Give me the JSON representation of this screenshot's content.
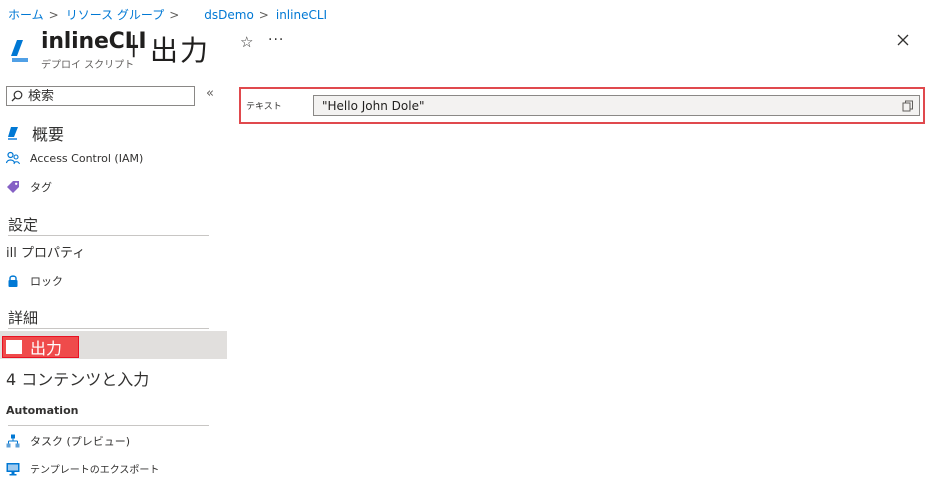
{
  "breadcrumb": {
    "home": "ホーム",
    "resource_groups": "リソース グループ",
    "resource_group": "dsDemo",
    "current": "inlineCLI",
    "separator": ">"
  },
  "header": {
    "title": "inlineCLI",
    "divider": "|",
    "page": "出力",
    "subtitle": "デプロイ スクリプト",
    "more": "···"
  },
  "search": {
    "placeholder": "検索",
    "collapse": "«"
  },
  "nav": {
    "overview": "概要",
    "iam": "Access Control (IAM)",
    "tags": "タグ",
    "settings_header": "設定",
    "properties": "ill プロパティ",
    "locks": "ロック",
    "details_header": "詳細",
    "output": "出力",
    "content_input": "4 コンテンツと入力",
    "automation_header": "Automation",
    "tasks": "タスク (プレビュー)",
    "export_template": "テンプレートのエクスポート"
  },
  "output": {
    "label": "テキスト",
    "value": "\"Hello John Dole\""
  },
  "colors": {
    "accent": "#0078d4",
    "highlight_red": "#e0494d",
    "selected_bg": "#e1dfdd"
  }
}
